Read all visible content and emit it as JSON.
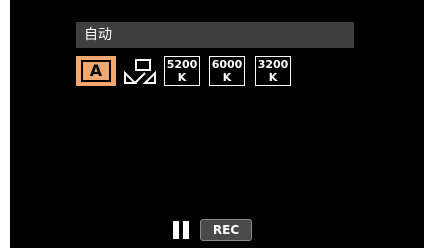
{
  "menu": {
    "title": "自动"
  },
  "white_balance": {
    "options": [
      {
        "name": "auto",
        "label": "A",
        "selected": true
      },
      {
        "name": "manual",
        "icon": "white-balance-manual-icon",
        "selected": false
      },
      {
        "name": "5200k",
        "value": "5200",
        "unit": "K",
        "selected": false
      },
      {
        "name": "6000k",
        "value": "6000",
        "unit": "K",
        "selected": false
      },
      {
        "name": "3200k",
        "value": "3200",
        "unit": "K",
        "selected": false
      }
    ],
    "highlight_color": "#f0a870"
  },
  "status": {
    "pause_icon": "pause-icon",
    "rec_label": "REC"
  }
}
